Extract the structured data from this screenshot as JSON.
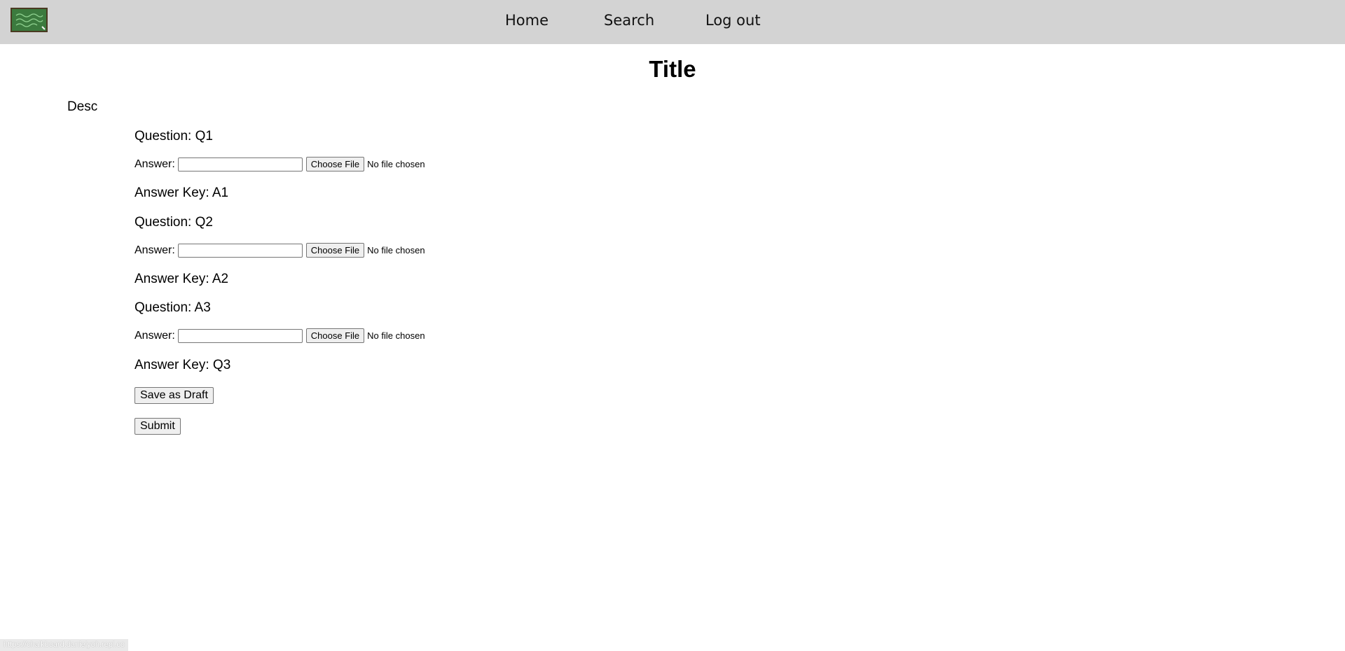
{
  "nav": {
    "logo_icon": "chalkboard-logo-icon",
    "links": [
      "Home",
      "Search",
      "Log out"
    ]
  },
  "page": {
    "title": "Title",
    "description": "Desc"
  },
  "questions": [
    {
      "question": "Question: Q1",
      "answer_label": "Answer:",
      "answer_value": "",
      "file_button": "Choose File",
      "file_status": "No file chosen",
      "answer_key": "Answer Key: A1"
    },
    {
      "question": "Question: Q2",
      "answer_label": "Answer:",
      "answer_value": "",
      "file_button": "Choose File",
      "file_status": "No file chosen",
      "answer_key": "Answer Key: A2"
    },
    {
      "question": "Question: A3",
      "answer_label": "Answer:",
      "answer_value": "",
      "file_button": "Choose File",
      "file_status": "No file chosen",
      "answer_key": "Answer Key: Q3"
    }
  ],
  "actions": {
    "save_draft": "Save as Draft",
    "submit": "Submit"
  },
  "status_bar": {
    "url": "https://chalkboard.danielyoh.repl.co"
  },
  "colors": {
    "navbar_bg": "#d3d3d3",
    "logo_board": "#3b7a3e",
    "logo_frame": "#4a3a22"
  }
}
